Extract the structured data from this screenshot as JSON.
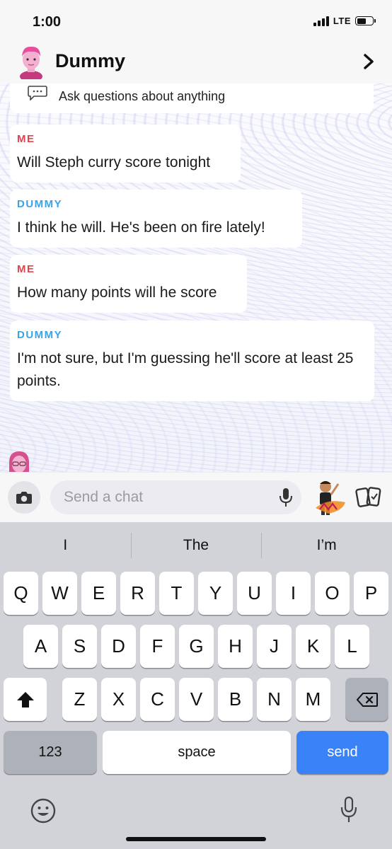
{
  "status_bar": {
    "time": "1:00",
    "network": "LTE",
    "battery_level": 0.6
  },
  "header": {
    "title": "Dummy",
    "avatar_icon": "bitmoji-avatar-pink-hair",
    "chevron_icon": "chevron-right-icon"
  },
  "intro_card": {
    "text": "Ask questions about anything",
    "icon": "chat-bubble-icon"
  },
  "messages": [
    {
      "sender": "ME",
      "text": "Will Steph curry score tonight"
    },
    {
      "sender": "DUMMY",
      "text": "I think he will. He's been on fire lately!"
    },
    {
      "sender": "ME",
      "text": "How many points will he score"
    },
    {
      "sender": "DUMMY",
      "text": "I'm not sure, but I'm guessing he'll score at least 25 points."
    }
  ],
  "input_bar": {
    "placeholder": "Send a chat",
    "camera_icon": "camera-icon",
    "mic_icon": "microphone-icon",
    "bitmoji_icon": "bitmoji-sticker-icon",
    "cards_icon": "cards-icon"
  },
  "keyboard": {
    "suggestions": [
      "I",
      "The",
      "I’m"
    ],
    "row1": [
      "Q",
      "W",
      "E",
      "R",
      "T",
      "Y",
      "U",
      "I",
      "O",
      "P"
    ],
    "row2": [
      "A",
      "S",
      "D",
      "F",
      "G",
      "H",
      "J",
      "K",
      "L"
    ],
    "row3": [
      "Z",
      "X",
      "C",
      "V",
      "B",
      "N",
      "M"
    ],
    "numbers_label": "123",
    "space_label": "space",
    "send_label": "send",
    "shift_icon": "shift-icon",
    "backspace_icon": "backspace-icon",
    "emoji_icon": "emoji-icon",
    "dictation_icon": "microphone-icon"
  },
  "colors": {
    "me": "#e0424e",
    "bot": "#3aa3e6",
    "send_key": "#3a82f7"
  }
}
